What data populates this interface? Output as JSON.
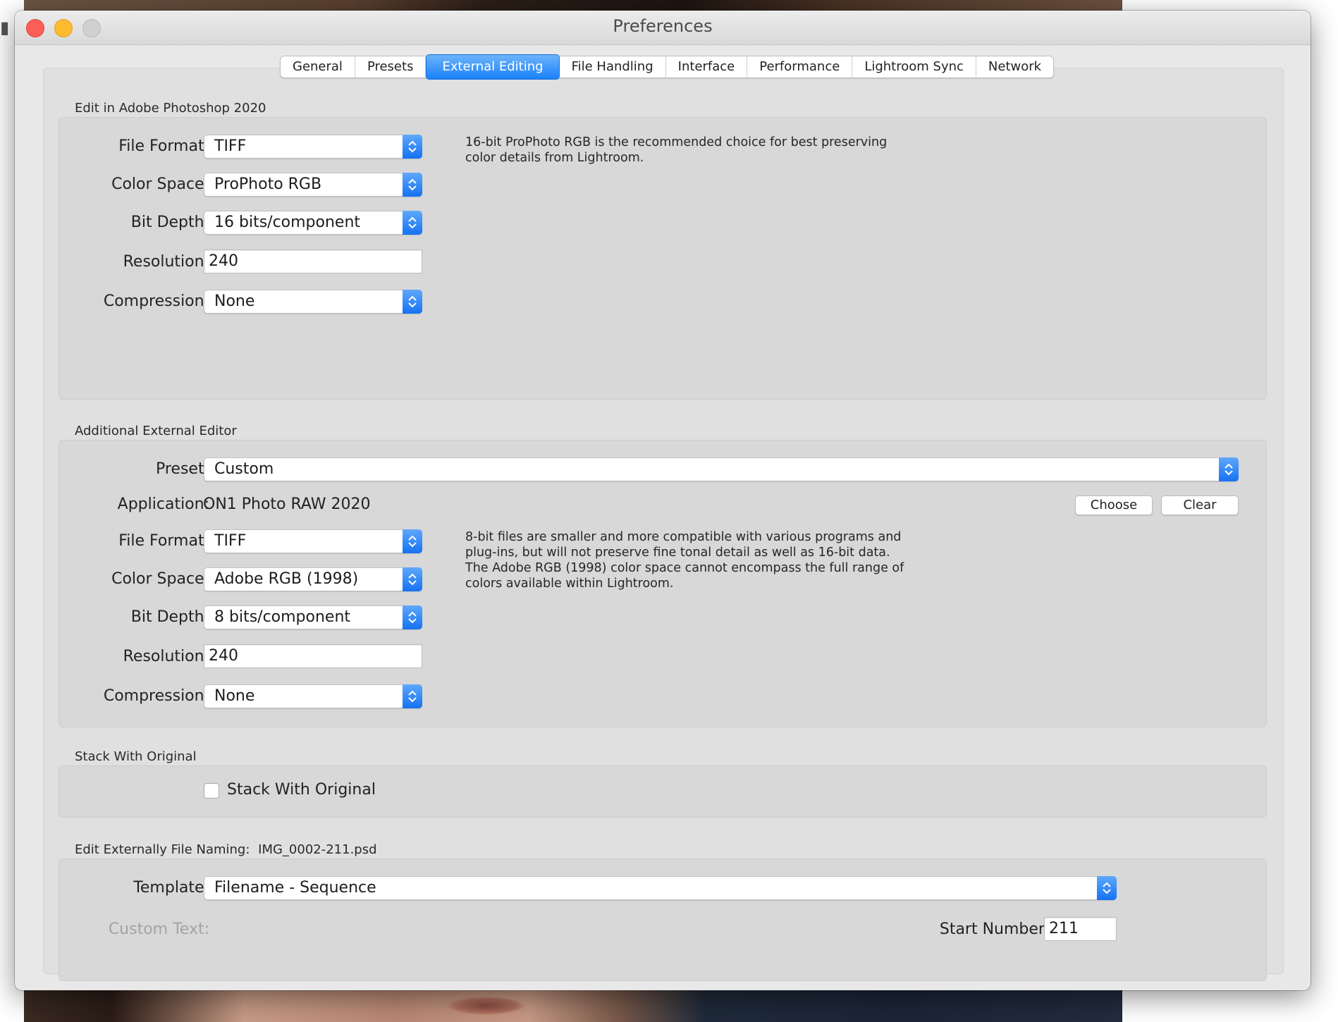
{
  "window": {
    "title": "Preferences"
  },
  "tabs": [
    "General",
    "Presets",
    "External Editing",
    "File Handling",
    "Interface",
    "Performance",
    "Lightroom Sync",
    "Network"
  ],
  "active_tab": "External Editing",
  "photoshop": {
    "section_title": "Edit in Adobe Photoshop 2020",
    "file_format_label": "File Format:",
    "file_format": "TIFF",
    "color_space_label": "Color Space:",
    "color_space": "ProPhoto RGB",
    "bit_depth_label": "Bit Depth:",
    "bit_depth": "16 bits/component",
    "resolution_label": "Resolution:",
    "resolution": "240",
    "compression_label": "Compression:",
    "compression": "None",
    "note": "16-bit ProPhoto RGB is the recommended choice for best preserving color details from Lightroom."
  },
  "additional": {
    "section_title": "Additional External Editor",
    "preset_label": "Preset:",
    "preset": "Custom",
    "application_label": "Application:",
    "application": "ON1 Photo RAW 2020",
    "choose_button": "Choose",
    "clear_button": "Clear",
    "file_format_label": "File Format:",
    "file_format": "TIFF",
    "color_space_label": "Color Space:",
    "color_space": "Adobe RGB (1998)",
    "bit_depth_label": "Bit Depth:",
    "bit_depth": "8 bits/component",
    "resolution_label": "Resolution:",
    "resolution": "240",
    "compression_label": "Compression:",
    "compression": "None",
    "note": "8-bit files are smaller and more compatible with various programs and plug-ins, but will not preserve fine tonal detail as well as 16-bit data. The Adobe RGB (1998) color space cannot encompass the full range of colors available within Lightroom."
  },
  "stack": {
    "section_title": "Stack With Original",
    "checkbox_label": "Stack With Original",
    "checked": false
  },
  "naming": {
    "section_title": "Edit Externally File Naming:",
    "example": "IMG_0002-211.psd",
    "template_label": "Template:",
    "template": "Filename - Sequence",
    "custom_text_label": "Custom Text:",
    "start_number_label": "Start Number:",
    "start_number": "211"
  },
  "colors": {
    "accent": "#1a82fb",
    "window_bg": "#e8e8e8",
    "group_bg": "#d8d8d8"
  }
}
